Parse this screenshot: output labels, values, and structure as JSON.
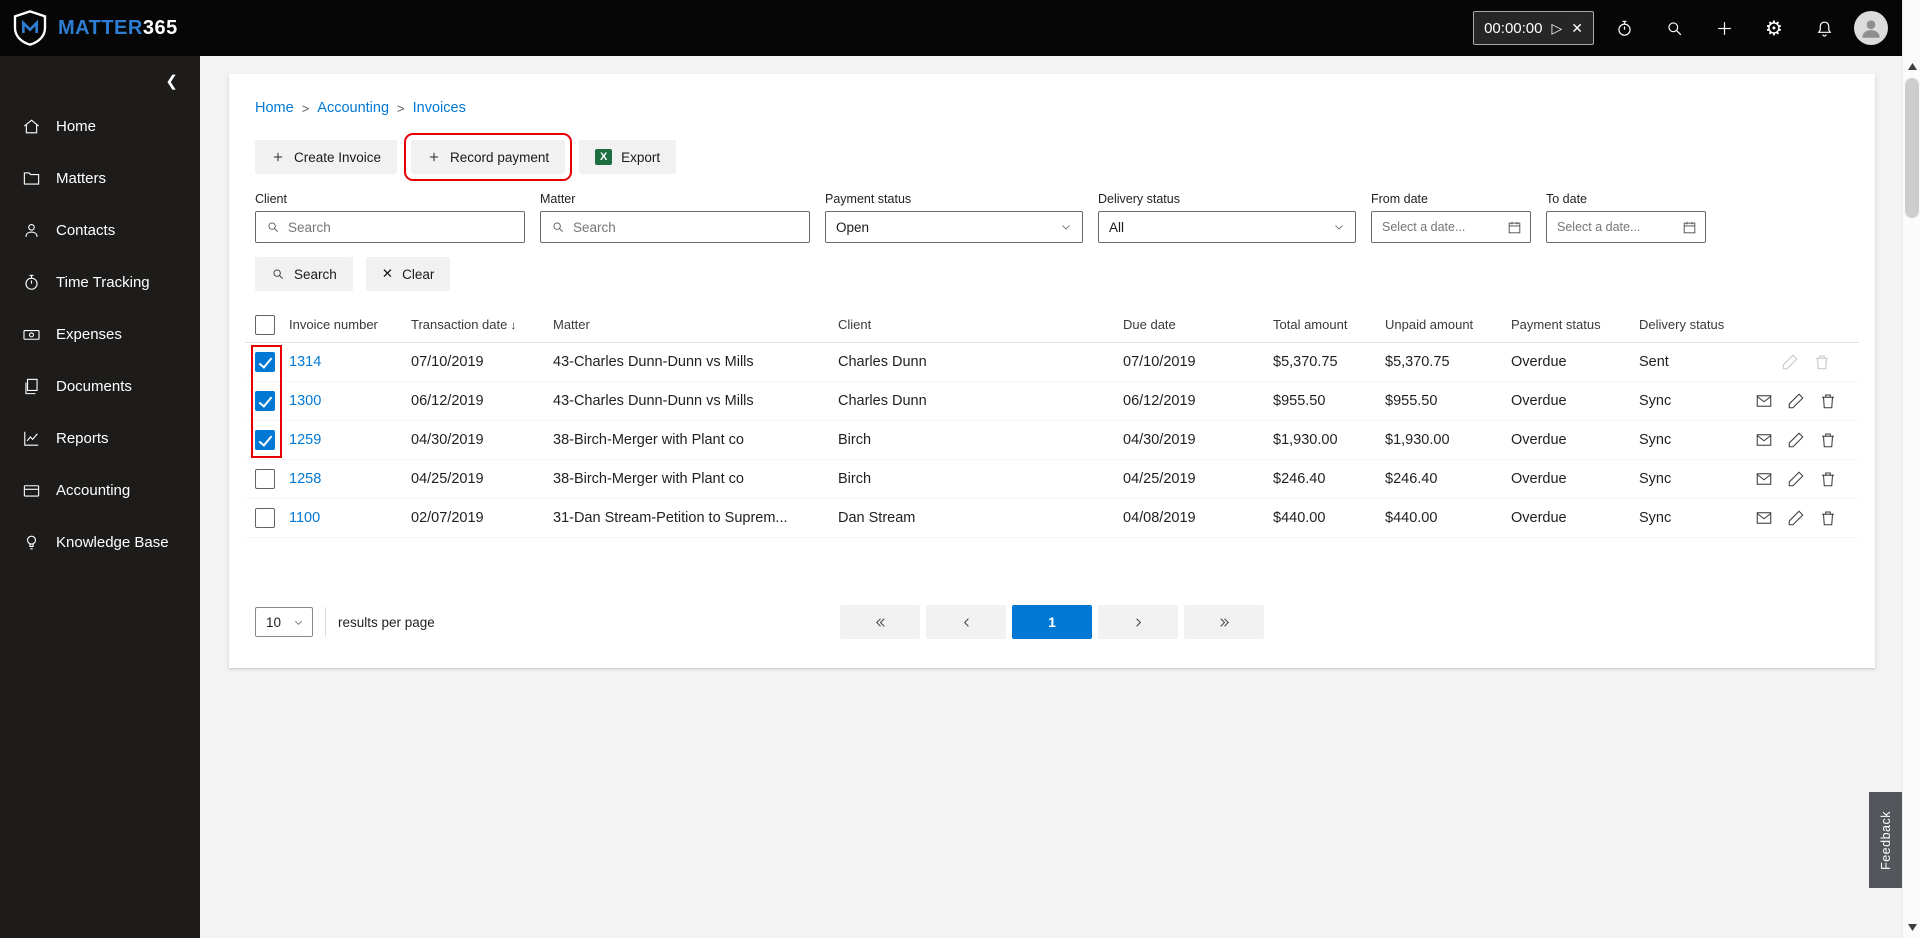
{
  "topbar": {
    "brand_primary": "MATTER",
    "brand_secondary": "365",
    "timer": {
      "value": "00:00:00",
      "play_glyph": "▷",
      "close_glyph": "✕"
    },
    "gear_glyph": "⚙"
  },
  "sidebar": {
    "collapse_glyph": "❮",
    "items": [
      {
        "label": "Home"
      },
      {
        "label": "Matters"
      },
      {
        "label": "Contacts"
      },
      {
        "label": "Time Tracking"
      },
      {
        "label": "Expenses"
      },
      {
        "label": "Documents"
      },
      {
        "label": "Reports"
      },
      {
        "label": "Accounting"
      },
      {
        "label": "Knowledge Base"
      }
    ]
  },
  "breadcrumb": {
    "items": [
      "Home",
      "Accounting",
      "Invoices"
    ],
    "separator": ">"
  },
  "toolbar": {
    "create_invoice": "Create Invoice",
    "record_payment": "Record payment",
    "export": "Export",
    "excel_glyph": "X"
  },
  "filters": {
    "client": {
      "label": "Client",
      "placeholder": "Search"
    },
    "matter": {
      "label": "Matter",
      "placeholder": "Search"
    },
    "payment_status": {
      "label": "Payment status",
      "value": "Open"
    },
    "delivery_status": {
      "label": "Delivery status",
      "value": "All"
    },
    "from_date": {
      "label": "From date",
      "placeholder": "Select a date..."
    },
    "to_date": {
      "label": "To date",
      "placeholder": "Select a date..."
    },
    "search_label": "Search",
    "clear_label": "Clear",
    "clear_glyph": "✕"
  },
  "table": {
    "headers": {
      "invoice": "Invoice number",
      "transaction_date": "Transaction date",
      "sort_glyph": "↓",
      "matter": "Matter",
      "client": "Client",
      "due_date": "Due date",
      "total": "Total amount",
      "unpaid": "Unpaid amount",
      "payment_status": "Payment status",
      "delivery_status": "Delivery status"
    },
    "rows": [
      {
        "checked": true,
        "invoice": "1314",
        "transaction_date": "07/10/2019",
        "matter": "43-Charles Dunn-Dunn vs Mills",
        "client": "Charles Dunn",
        "due_date": "07/10/2019",
        "total_amount": "$5,370.75",
        "unpaid_amount": "$5,370.75",
        "payment_status": "Overdue",
        "delivery_status": "Sent"
      },
      {
        "checked": true,
        "invoice": "1300",
        "transaction_date": "06/12/2019",
        "matter": "43-Charles Dunn-Dunn vs Mills",
        "client": "Charles Dunn",
        "due_date": "06/12/2019",
        "total_amount": "$955.50",
        "unpaid_amount": "$955.50",
        "payment_status": "Overdue",
        "delivery_status": "Sync"
      },
      {
        "checked": true,
        "invoice": "1259",
        "transaction_date": "04/30/2019",
        "matter": "38-Birch-Merger with Plant co",
        "client": "Birch",
        "due_date": "04/30/2019",
        "total_amount": "$1,930.00",
        "unpaid_amount": "$1,930.00",
        "payment_status": "Overdue",
        "delivery_status": "Sync"
      },
      {
        "checked": false,
        "invoice": "1258",
        "transaction_date": "04/25/2019",
        "matter": "38-Birch-Merger with Plant co",
        "client": "Birch",
        "due_date": "04/25/2019",
        "total_amount": "$246.40",
        "unpaid_amount": "$246.40",
        "payment_status": "Overdue",
        "delivery_status": "Sync"
      },
      {
        "checked": false,
        "invoice": "1100",
        "transaction_date": "02/07/2019",
        "matter": "31-Dan Stream-Petition to Suprem...",
        "client": "Dan Stream",
        "due_date": "04/08/2019",
        "total_amount": "$440.00",
        "unpaid_amount": "$440.00",
        "payment_status": "Overdue",
        "delivery_status": "Sync"
      }
    ]
  },
  "pagination": {
    "per_page": "10",
    "per_page_label": "results per page",
    "current_page": "1"
  },
  "feedback": {
    "label": "Feedback"
  },
  "colors": {
    "accent": "#0078d4",
    "annotation_red": "#e80000",
    "brand_blue": "#2d7dd2",
    "excel_green": "#1d6f42"
  }
}
